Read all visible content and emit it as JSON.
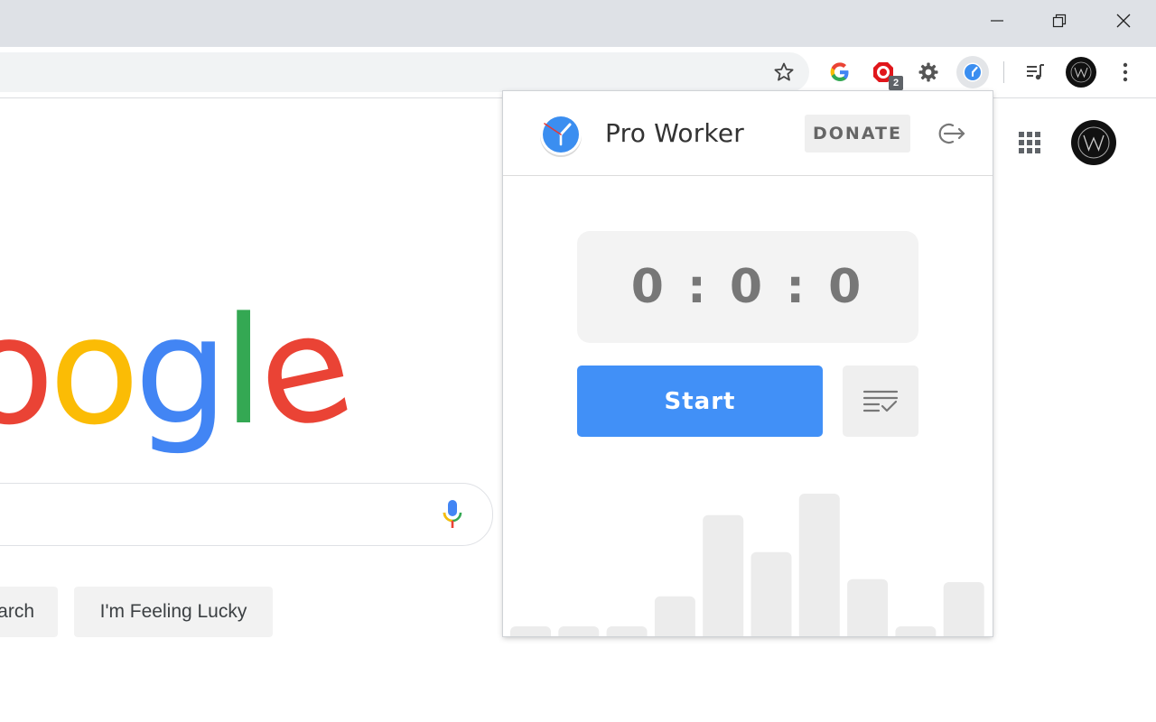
{
  "window": {
    "controls": [
      "minimize-icon",
      "restore-icon",
      "close-icon"
    ]
  },
  "toolbar": {
    "bookmark_icon": "star-icon",
    "extensions": [
      "google-icon",
      "adblock-icon",
      "gear-icon",
      "pro-worker-icon",
      "media-queue-icon",
      "profile-avatar"
    ],
    "adblock_badge": "2",
    "menu_icon": "more-vert-icon"
  },
  "google": {
    "logo_letters": [
      {
        "char": "o",
        "color": "#EA4335"
      },
      {
        "char": "o",
        "color": "#FBBC05"
      },
      {
        "char": "g",
        "color": "#4285F4"
      },
      {
        "char": "l",
        "color": "#34A853"
      },
      {
        "char": "e",
        "color": "#EA4335"
      }
    ],
    "search_button_partial": "arch",
    "lucky_button": "I'm Feeling Lucky"
  },
  "popup": {
    "title": "Pro Worker",
    "donate_label": "DONATE",
    "timer": "0 : 0 : 0",
    "start_label": "Start",
    "colors": {
      "accent": "#4190f7",
      "panel": "#f3f3f3"
    },
    "history_chart": {
      "type": "bar",
      "values": [
        0.07,
        0.07,
        0.07,
        0.28,
        0.85,
        0.59,
        1.0,
        0.4,
        0.07,
        0.38
      ]
    }
  }
}
